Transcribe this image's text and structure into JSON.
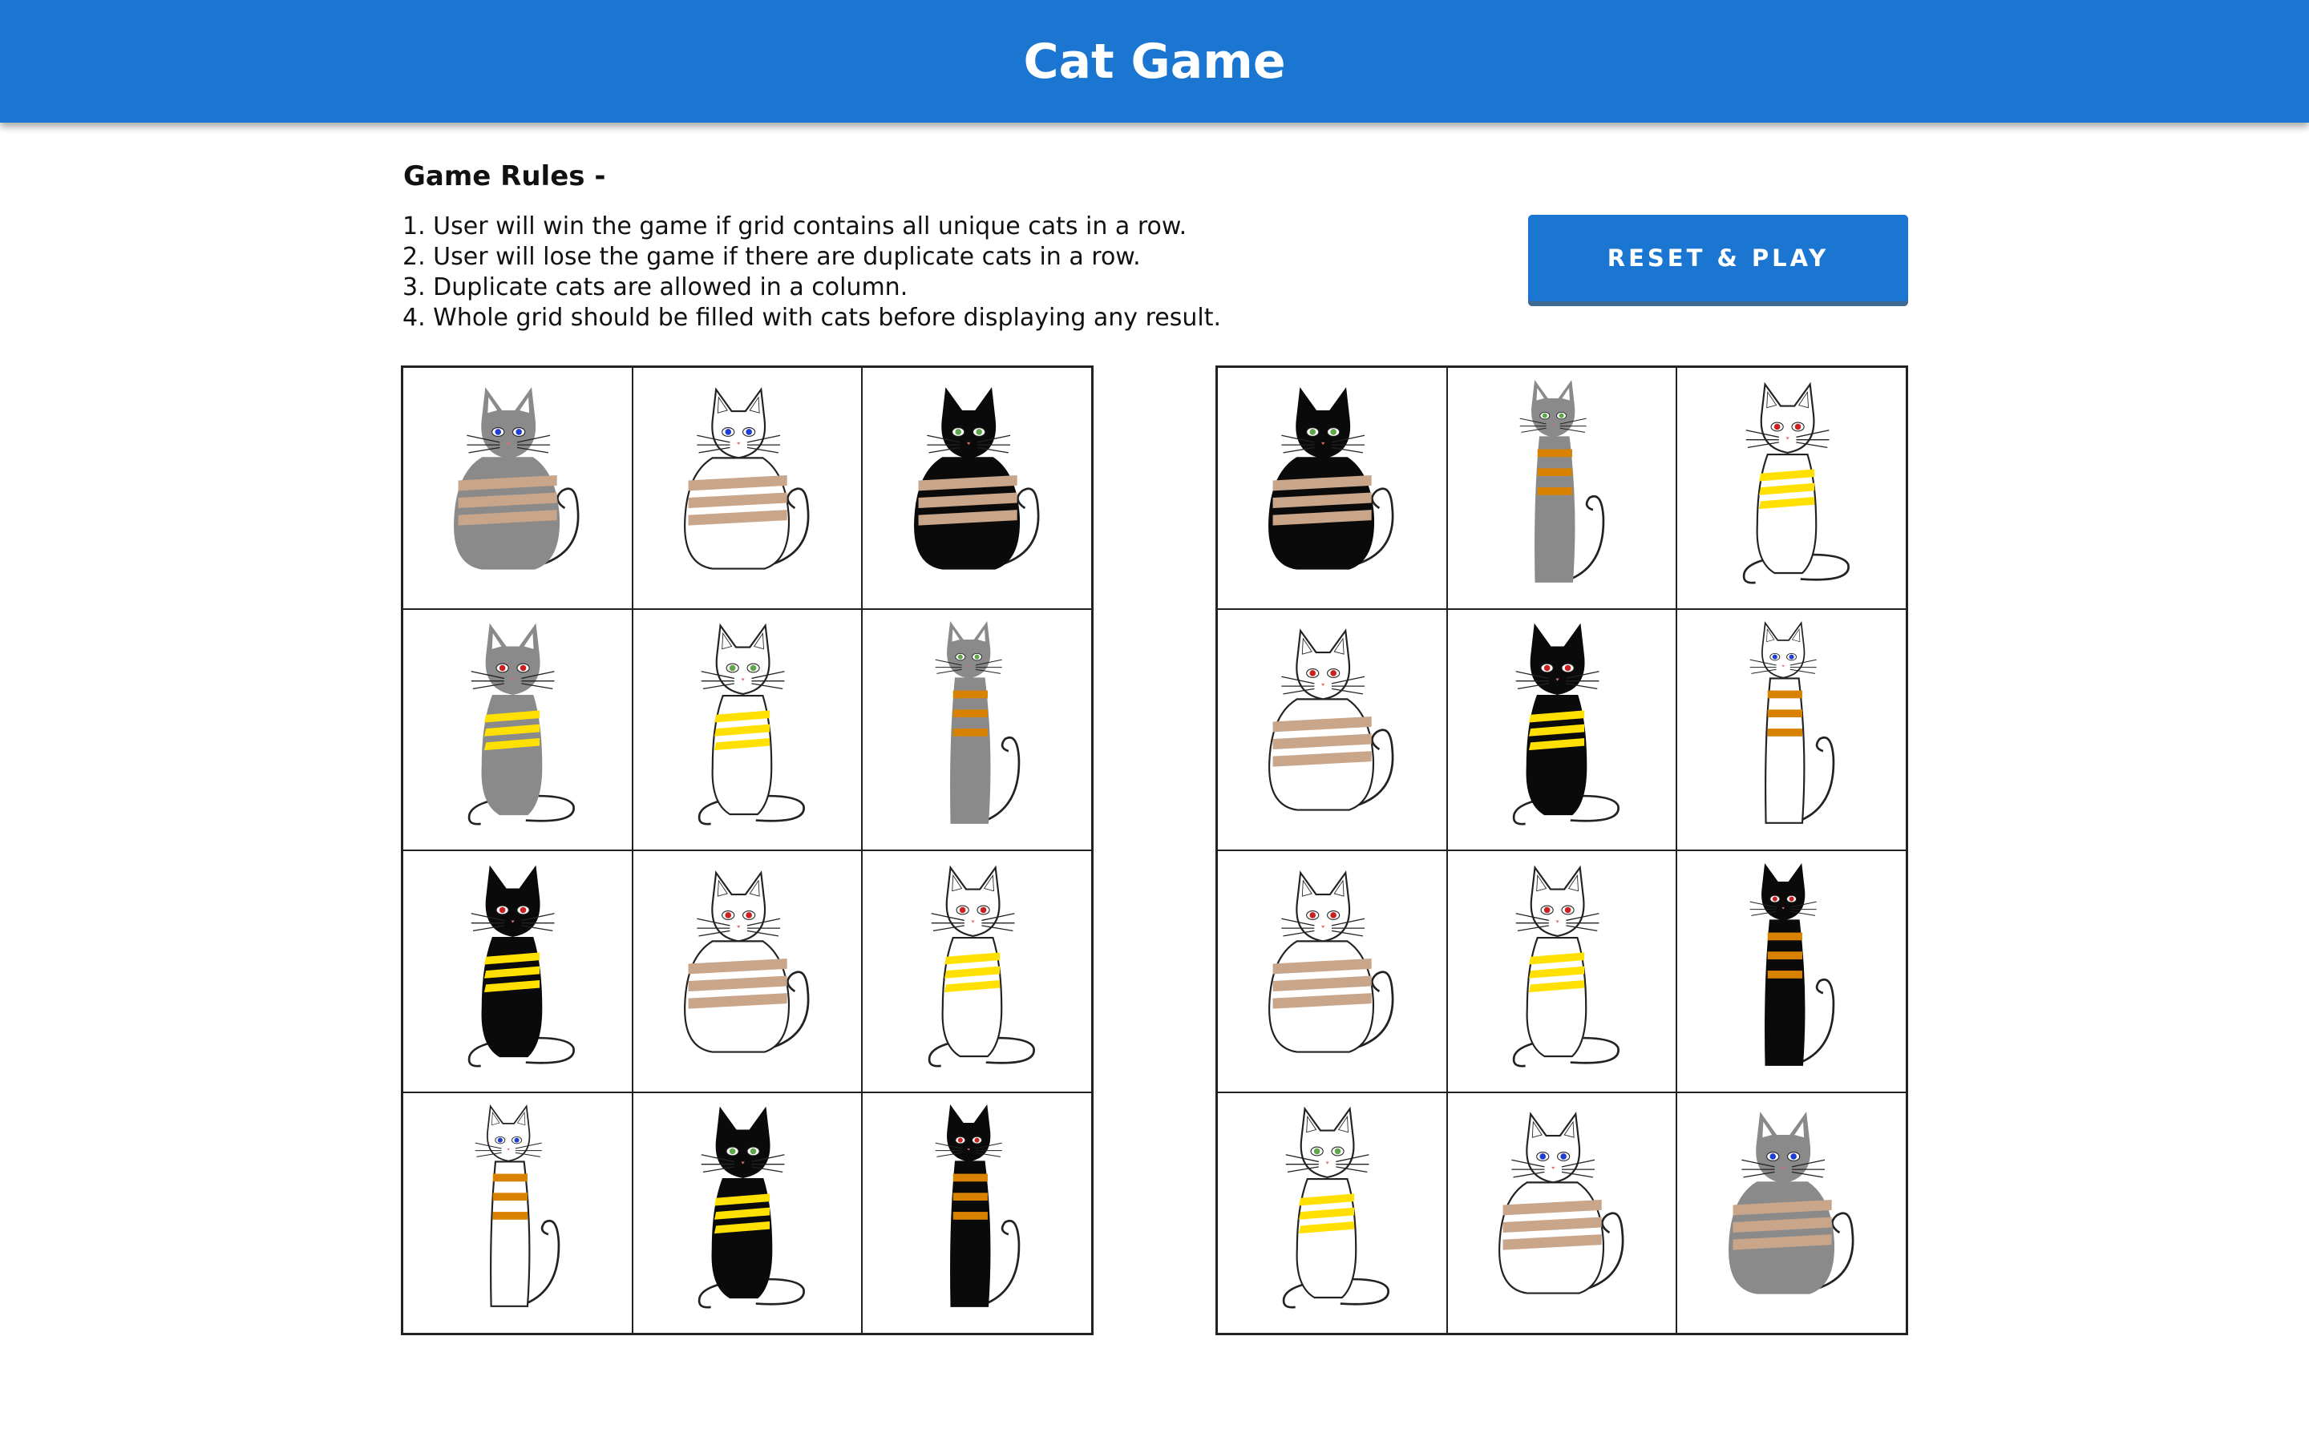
{
  "header": {
    "title": "Cat Game"
  },
  "rules": {
    "title": "Game Rules -",
    "items": [
      "1. User will win the game if grid contains all unique cats in a row.",
      "2. User will lose the game if there are duplicate cats in a row.",
      "3. Duplicate cats are allowed in a column.",
      "4. Whole grid should be filled with cats before displaying any result."
    ]
  },
  "reset_button": {
    "label": "RESET & PLAY"
  },
  "colors": {
    "header": "#1b76d2",
    "button": "#1b76d2",
    "fur": {
      "gray": "#8a8a8a",
      "black": "#0a0a0a",
      "white": "#ffffff"
    },
    "stripe": {
      "tan": "#c9a58a",
      "yellow": "#ffe000",
      "orange": "#d98200"
    },
    "eye": {
      "blue": "#1e3fd0",
      "green": "#5fa84a",
      "red": "#cc2020"
    }
  },
  "grids": [
    {
      "cells": [
        {
          "shape": "round",
          "fur": "gray",
          "stripe": "tan",
          "eye": "blue"
        },
        {
          "shape": "round",
          "fur": "white",
          "stripe": "tan",
          "eye": "blue"
        },
        {
          "shape": "round",
          "fur": "black",
          "stripe": "tan",
          "eye": "green"
        },
        {
          "shape": "sitting",
          "fur": "gray",
          "stripe": "yellow",
          "eye": "red"
        },
        {
          "shape": "sitting",
          "fur": "white",
          "stripe": "yellow",
          "eye": "green"
        },
        {
          "shape": "slim",
          "fur": "gray",
          "stripe": "orange",
          "eye": "green"
        },
        {
          "shape": "sitting",
          "fur": "black",
          "stripe": "yellow",
          "eye": "red"
        },
        {
          "shape": "round",
          "fur": "white",
          "stripe": "tan",
          "eye": "red"
        },
        {
          "shape": "sitting",
          "fur": "white",
          "stripe": "yellow",
          "eye": "red"
        },
        {
          "shape": "slim",
          "fur": "white",
          "stripe": "orange",
          "eye": "blue"
        },
        {
          "shape": "sitting",
          "fur": "black",
          "stripe": "yellow",
          "eye": "green"
        },
        {
          "shape": "slim",
          "fur": "black",
          "stripe": "orange",
          "eye": "red"
        }
      ]
    },
    {
      "cells": [
        {
          "shape": "round",
          "fur": "black",
          "stripe": "tan",
          "eye": "green"
        },
        {
          "shape": "slim",
          "fur": "gray",
          "stripe": "orange",
          "eye": "green"
        },
        {
          "shape": "sitting",
          "fur": "white",
          "stripe": "yellow",
          "eye": "red"
        },
        {
          "shape": "round",
          "fur": "white",
          "stripe": "tan",
          "eye": "red"
        },
        {
          "shape": "sitting",
          "fur": "black",
          "stripe": "yellow",
          "eye": "red"
        },
        {
          "shape": "slim",
          "fur": "white",
          "stripe": "orange",
          "eye": "blue"
        },
        {
          "shape": "round",
          "fur": "white",
          "stripe": "tan",
          "eye": "red"
        },
        {
          "shape": "sitting",
          "fur": "white",
          "stripe": "yellow",
          "eye": "red"
        },
        {
          "shape": "slim",
          "fur": "black",
          "stripe": "orange",
          "eye": "red"
        },
        {
          "shape": "sitting",
          "fur": "white",
          "stripe": "yellow",
          "eye": "green"
        },
        {
          "shape": "round",
          "fur": "white",
          "stripe": "tan",
          "eye": "blue"
        },
        {
          "shape": "round",
          "fur": "gray",
          "stripe": "tan",
          "eye": "blue"
        }
      ]
    }
  ]
}
